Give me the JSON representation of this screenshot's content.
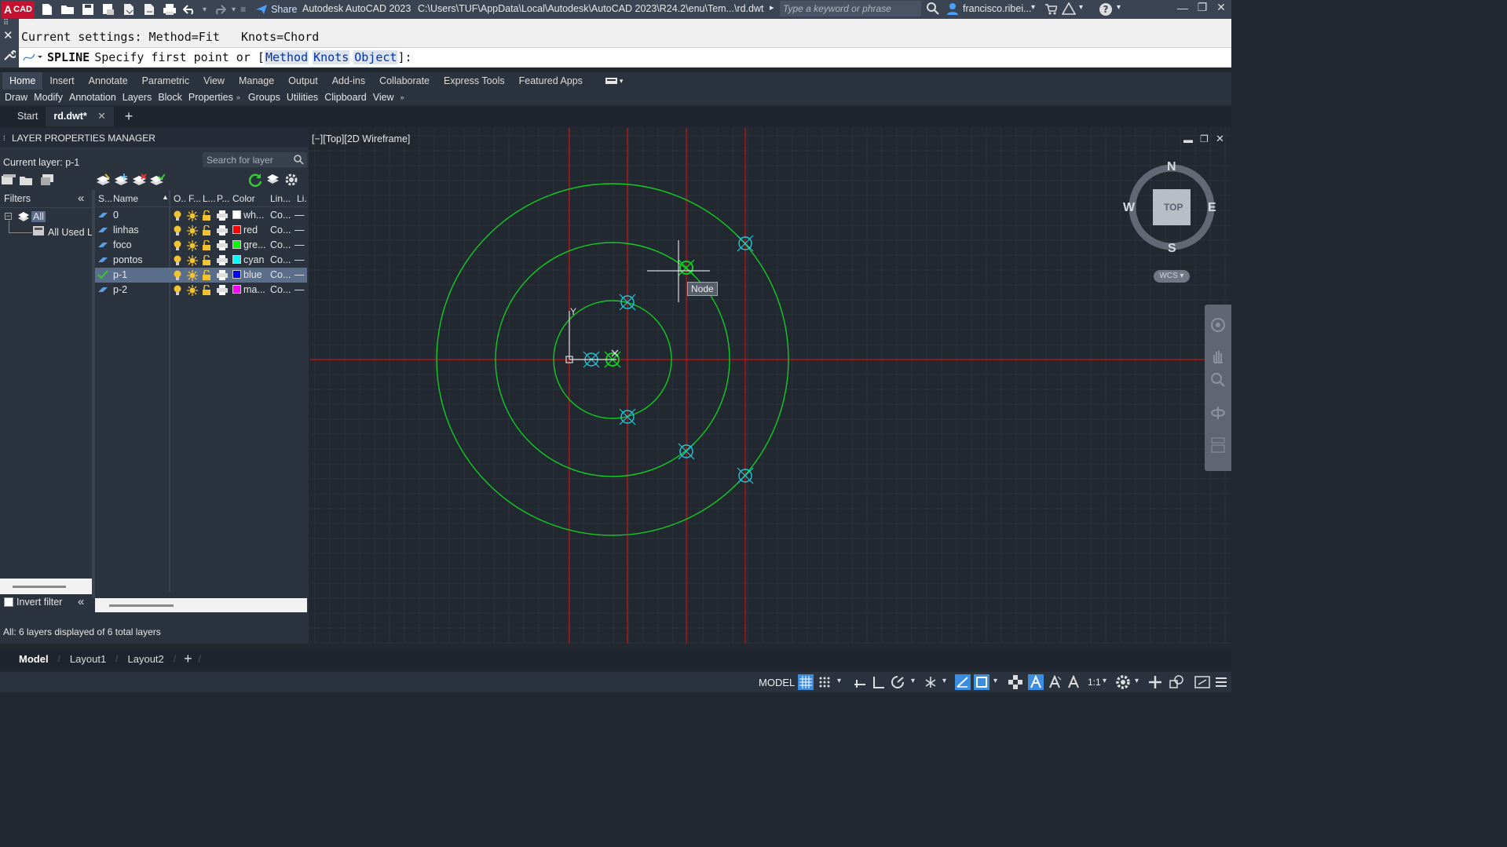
{
  "app": {
    "badge": "CAD",
    "title": "Autodesk AutoCAD 2023",
    "path": "C:\\Users\\TUF\\AppData\\Local\\Autodesk\\AutoCAD 2023\\R24.2\\enu\\Tem...\\rd.dwt",
    "share": "Share",
    "search_placeholder": "Type a keyword or phrase",
    "user": "francisco.ribei..."
  },
  "command": {
    "history": "Current settings: Method=Fit   Knots=Chord",
    "name": "SPLINE",
    "prompt": "Specify first point or [",
    "options": [
      "Method",
      "Knots",
      "Object"
    ],
    "suffix": "]:"
  },
  "ribbon": {
    "tabs": [
      "Home",
      "Insert",
      "Annotate",
      "Parametric",
      "View",
      "Manage",
      "Output",
      "Add-ins",
      "Collaborate",
      "Express Tools",
      "Featured Apps"
    ],
    "panels": [
      "Draw",
      "Modify",
      "Annotation",
      "Layers",
      "Block",
      "Properties",
      "Groups",
      "Utilities",
      "Clipboard",
      "View"
    ]
  },
  "doc_tabs": [
    "Start",
    "rd.dwt*"
  ],
  "layer_manager": {
    "title": "LAYER PROPERTIES MANAGER",
    "current_layer": "Current layer: p-1",
    "search_placeholder": "Search for layer",
    "filters_label": "Filters",
    "tree": [
      "All",
      "All Used L"
    ],
    "columns": [
      "S...",
      "Name",
      "O..",
      "F...",
      "L...",
      "P...",
      "Color",
      "Lin...",
      "Li."
    ],
    "layers": [
      {
        "name": "0",
        "color": "wh...",
        "swatch": "#ffffff",
        "linetype": "Co...",
        "lw": "—"
      },
      {
        "name": "linhas",
        "color": "red",
        "swatch": "#ff0000",
        "linetype": "Co...",
        "lw": "—"
      },
      {
        "name": "foco",
        "color": "gre...",
        "swatch": "#00ff00",
        "linetype": "Co...",
        "lw": "—"
      },
      {
        "name": "pontos",
        "color": "cyan",
        "swatch": "#00ffff",
        "linetype": "Co...",
        "lw": "—"
      },
      {
        "name": "p-1",
        "color": "blue",
        "swatch": "#0000ff",
        "linetype": "Co...",
        "lw": "—"
      },
      {
        "name": "p-2",
        "color": "ma...",
        "swatch": "#ff00ff",
        "linetype": "Co...",
        "lw": "—"
      }
    ],
    "invert_filter": "Invert filter",
    "status": "All: 6 layers displayed of 6 total layers"
  },
  "viewport": {
    "label": "[−][Top][2D Wireframe]",
    "tooltip": "Node",
    "ucs_y": "Y",
    "viewcube": {
      "n": "N",
      "s": "S",
      "e": "E",
      "w": "W",
      "face": "TOP",
      "wcs": "WCS"
    }
  },
  "layout_tabs": [
    "Model",
    "Layout1",
    "Layout2"
  ],
  "status": {
    "model": "MODEL",
    "scale": "1:1"
  },
  "colors": {
    "accent": "#3b8de0",
    "green": "#11cc22",
    "red": "#cc1111",
    "cyan": "#22c8d8"
  }
}
